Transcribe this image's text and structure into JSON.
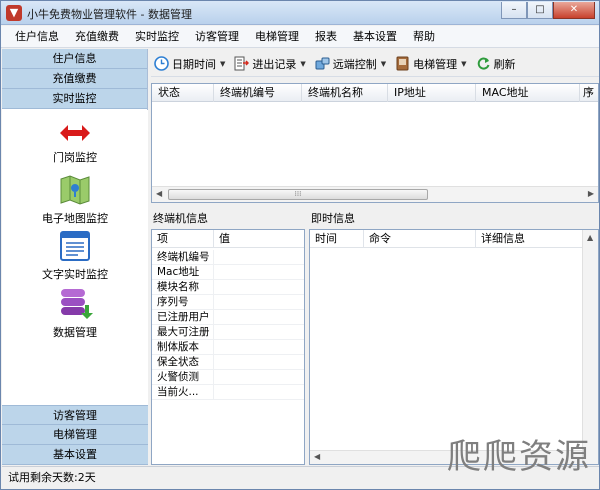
{
  "window": {
    "title": "小牛免费物业管理软件 - 数据管理",
    "min": "–",
    "max": "□",
    "close": "✕"
  },
  "menu": [
    "住户信息",
    "充值缴费",
    "实时监控",
    "访客管理",
    "电梯管理",
    "报表",
    "基本设置",
    "帮助"
  ],
  "sidebar": {
    "top": [
      "住户信息",
      "充值缴费",
      "实时监控"
    ],
    "tools": [
      "门岗监控",
      "电子地图监控",
      "文字实时监控",
      "数据管理"
    ],
    "bottom": [
      "访客管理",
      "电梯管理",
      "基本设置"
    ]
  },
  "toolbar": [
    {
      "label": "日期时间",
      "dropdown": true
    },
    {
      "label": "进出记录",
      "dropdown": true
    },
    {
      "label": "远端控制",
      "dropdown": true
    },
    {
      "label": "电梯管理",
      "dropdown": true
    },
    {
      "label": "刷新",
      "dropdown": false
    }
  ],
  "grid": {
    "columns": [
      "状态",
      "终端机编号",
      "终端机名称",
      "IP地址",
      "MAC地址",
      "序"
    ],
    "scroll_grip": "⁞⁞⁞"
  },
  "terminal_info": {
    "label": "终端机信息",
    "columns": [
      "项",
      "值"
    ],
    "rows": [
      "终端机编号",
      "Mac地址",
      "模块名称",
      "序列号",
      "已注册用户",
      "最大可注册",
      "制体版本",
      "保全状态",
      "火警侦测",
      "当前火..."
    ]
  },
  "live_info": {
    "label": "即时信息",
    "columns": [
      "时间",
      "命令",
      "详细信息"
    ]
  },
  "status": "试用剩余天数:2天",
  "watermark": "爬爬资源"
}
